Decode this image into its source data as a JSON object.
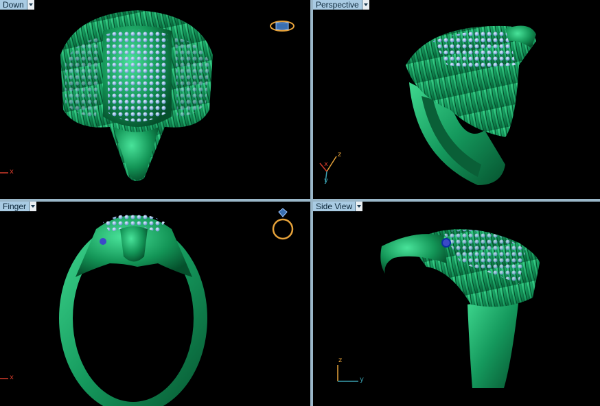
{
  "viewports": {
    "top": {
      "label": "Down"
    },
    "perspective": {
      "label": "Perspective"
    },
    "front": {
      "label": "Finger"
    },
    "side": {
      "label": "Side View"
    }
  },
  "axes": {
    "x": "x",
    "y": "y",
    "z": "z"
  },
  "icons": {
    "view_cube_top": "ring-top-icon",
    "view_cube_front": "ring-front-icon",
    "dropdown": "chevron-down-icon"
  },
  "colors": {
    "model_green": "#1fa66a",
    "gem_blue": "#8fb8e8",
    "header_bg": "#a9cbe3",
    "divider": "#9ab7c9",
    "axis_red": "#d23a2a",
    "axis_teal": "#3aa0b0",
    "axis_orange": "#e6a23a"
  }
}
